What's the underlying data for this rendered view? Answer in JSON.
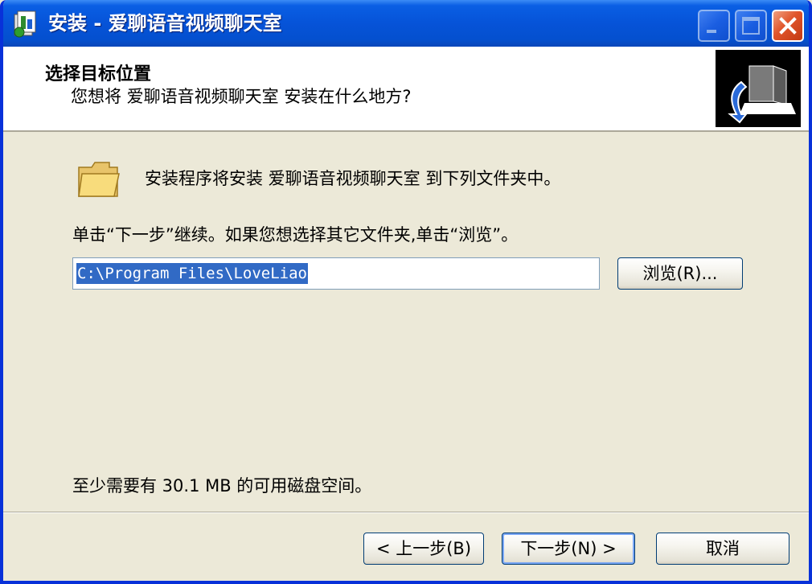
{
  "window": {
    "title": "安装 - 爱聊语音视频聊天室",
    "caption_buttons": {
      "minimize": "minimize-icon",
      "maximize": "maximize-icon",
      "close": "close-icon"
    },
    "colors": {
      "titlebar": "#0653D8",
      "frame": "#0831D9",
      "face": "#ECE9D8",
      "selection": "#316AC5"
    }
  },
  "header": {
    "title": "选择目标位置",
    "subtitle": "您想将 爱聊语音视频聊天室 安装在什么地方?",
    "image_icon": "computer-install-icon"
  },
  "body": {
    "folder_icon": "folder-icon",
    "intro": "安装程序将安装 爱聊语音视频聊天室 到下列文件夹中。",
    "instruction": "单击“下一步”继续。如果您想选择其它文件夹,单击“浏览”。",
    "path_value": "C:\\Program Files\\LoveLiao",
    "browse_label": "浏览(R)...",
    "disk_space": "至少需要有 30.1 MB 的可用磁盘空间。"
  },
  "footer": {
    "back_label": "< 上一步(B)",
    "next_label": "下一步(N) >",
    "cancel_label": "取消"
  }
}
